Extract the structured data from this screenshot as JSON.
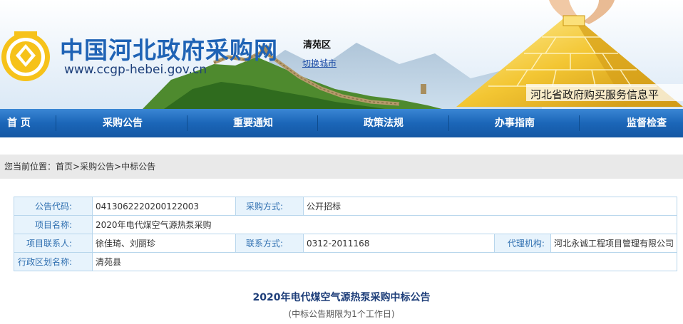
{
  "header": {
    "site_name": "中国河北政府采购网",
    "site_url": "www.ccgp-hebei.gov.cn",
    "region": "清苑区",
    "switch_city": "切换城市",
    "slogan": "河北省政府购买服务信息平"
  },
  "nav": {
    "items": [
      {
        "label": "首 页"
      },
      {
        "label": "采购公告"
      },
      {
        "label": "重要通知"
      },
      {
        "label": "政策法规"
      },
      {
        "label": "办事指南"
      },
      {
        "label": "监督检查"
      }
    ]
  },
  "breadcrumb": {
    "prefix": "您当前位置：",
    "home": "首页",
    "sep1": ">",
    "level1": "采购公告",
    "sep2": ">",
    "level2": "中标公告"
  },
  "info": {
    "code_label": "公告代码:",
    "code_value": "0413062220200122003",
    "method_label": "采购方式:",
    "method_value": "公开招标",
    "project_label": "项目名称:",
    "project_value": "2020年电代煤空气源热泵采购",
    "contact_label": "项目联系人:",
    "contact_value": "徐佳琦、刘丽珍",
    "phone_label": "联系方式:",
    "phone_value": "0312-2011168",
    "agency_label": "代理机构:",
    "agency_value": "河北永诚工程项目管理有限公司",
    "district_label": "行政区划名称:",
    "district_value": "清苑县"
  },
  "notice": {
    "title": "2020年电代煤空气源热泵采购中标公告",
    "subtitle": "(中标公告期限为1个工作日)"
  },
  "colors": {
    "nav_blue": "#1b66b8",
    "brand_blue": "#1f63b5",
    "label_bg": "#e7f3fc",
    "border": "#b8d6ec"
  }
}
